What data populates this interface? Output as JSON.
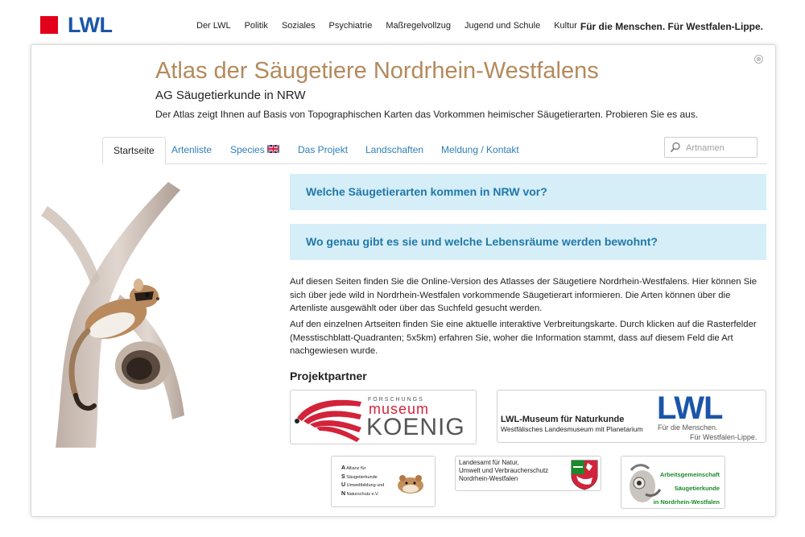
{
  "header": {
    "logo_text": "LWL",
    "nav": [
      "Der LWL",
      "Politik",
      "Soziales",
      "Psychiatrie",
      "Maßregelvollzug",
      "Jugend und Schule",
      "Kultur"
    ],
    "slogan": "Für die Menschen. Für Westfalen-Lippe."
  },
  "page": {
    "title": "Atlas der Säugetiere Nordrhein-Westfalens",
    "subtitle": "AG Säugetierkunde in NRW",
    "intro": "Der Atlas zeigt Ihnen auf Basis von Topographischen Karten das Vorkommen heimischer Säugetierarten. Probieren Sie es aus.",
    "close_icon": "⊗"
  },
  "tabs": [
    "Startseite",
    "Artenliste",
    "Species",
    "Das Projekt",
    "Landschaften",
    "Meldung / Kontakt"
  ],
  "search": {
    "placeholder": "Artnamen",
    "value": ""
  },
  "panels": [
    "Welche Säugetierarten kommen in NRW vor?",
    "Wo genau gibt es sie und welche Lebensräume werden bewohnt?"
  ],
  "body": {
    "p1": "Auf diesen Seiten finden Sie die Online-Version des Atlasses der Säugetiere Nordrhein-Westfalens. Hier können Sie sich über jede wild in Nordrhein-Westfalen vorkommende Säugetierart informieren. Die Arten können über die Artenliste ausgewählt oder über das Suchfeld gesucht werden.",
    "p2": "Auf den einzelnen Artseiten finden Sie eine aktuelle interaktive Verbreitungskarte. Durch klicken auf die Rasterfelder (Messtischblatt-Quadranten; 5x5km) erfahren Sie, woher die Information stammt, dass auf diesem Feld die Art nachgewiesen wurde."
  },
  "partners": {
    "title": "Projektpartner",
    "koenig": {
      "small": "FORSCHUNGS",
      "museum": "museum",
      "name": "KOENIG"
    },
    "lwl_museum": {
      "title": "LWL-Museum für Naturkunde",
      "subtitle": "Westfälisches Landesmuseum mit Planetarium",
      "logo": "LWL",
      "slogan1": "Für die Menschen.",
      "slogan2": "Für Westfalen-Lippe."
    },
    "asun": {
      "l1": "Allianz für",
      "l2": "Säugetierkunde",
      "l3": "Umweltbildung und",
      "l4": "Naturschutz e.V.",
      "letters": [
        "A",
        "S",
        "U",
        "N"
      ]
    },
    "landesamt": {
      "l1": "Landesamt für Natur,",
      "l2": "Umwelt und Verbraucherschutz",
      "l3": "Nordrhein-Westfalen"
    },
    "arbeitsgemeinschaft": {
      "l1": "Arbeitsgemeinschaft",
      "l2": "Säugetierkunde",
      "l3": "in Nordrhein-Westfalen"
    }
  },
  "colors": {
    "brand_blue": "#1a56a8",
    "brand_red": "#e2001a",
    "title_brown": "#b38a5c",
    "panel_bg": "#d5eef8",
    "link_blue": "#2d7fb8"
  }
}
